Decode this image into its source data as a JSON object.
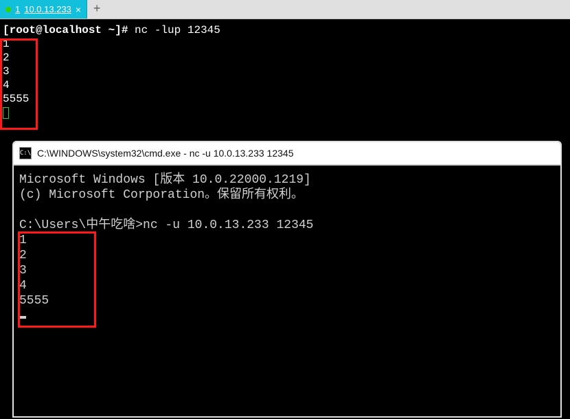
{
  "tabBar": {
    "activeTab": {
      "number": "1",
      "host": "10.0.13.233",
      "close": "×"
    },
    "addLabel": "+"
  },
  "topTerminal": {
    "promptUserHost": "[root@localhost ~]#",
    "command": "nc -lup 12345",
    "output": [
      "1",
      "2",
      "3",
      "4",
      "5555"
    ]
  },
  "cmdWindow": {
    "iconText": "C:\\",
    "title": "C:\\WINDOWS\\system32\\cmd.exe - nc  -u 10.0.13.233 12345",
    "header1": "Microsoft Windows [版本 10.0.22000.1219]",
    "header2": "(c) Microsoft Corporation。保留所有权利。",
    "promptPath": "C:\\Users\\中午吃啥>",
    "promptCmd": "nc -u 10.0.13.233 12345",
    "output": [
      "1",
      "2",
      "3",
      "4",
      "5555"
    ]
  }
}
